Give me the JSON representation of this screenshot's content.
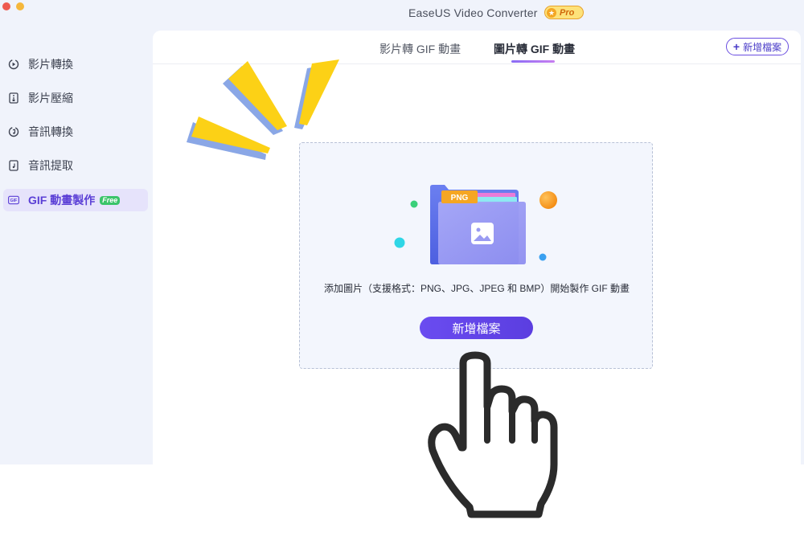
{
  "app": {
    "title": "EaseUS Video Converter",
    "pro_badge": "Pro"
  },
  "sidebar": {
    "items": [
      {
        "label": "影片轉換",
        "icon": "video-convert-icon"
      },
      {
        "label": "影片壓縮",
        "icon": "compress-icon"
      },
      {
        "label": "音訊轉換",
        "icon": "audio-convert-icon"
      },
      {
        "label": "音訊提取",
        "icon": "audio-extract-icon"
      },
      {
        "label": "GIF 動畫製作",
        "icon": "gif-icon",
        "badge": "Free",
        "active": true
      }
    ]
  },
  "tabs": [
    {
      "label": "影片轉 GIF 動畫",
      "active": false
    },
    {
      "label": "圖片轉 GIF 動畫",
      "active": true
    }
  ],
  "header": {
    "add_file_label": "新增檔案"
  },
  "dropzone": {
    "folder_tag": "PNG",
    "instruction": "添加圖片（支援格式：PNG、JPG、JPEG 和 BMP）開始製作 GIF 動畫",
    "button_label": "新增檔案"
  },
  "colors": {
    "accent": "#5b3fd6",
    "sidebar_bg": "#f0f3fb",
    "burst_yellow": "#fcd116",
    "burst_shadow": "#8aa7e6"
  }
}
